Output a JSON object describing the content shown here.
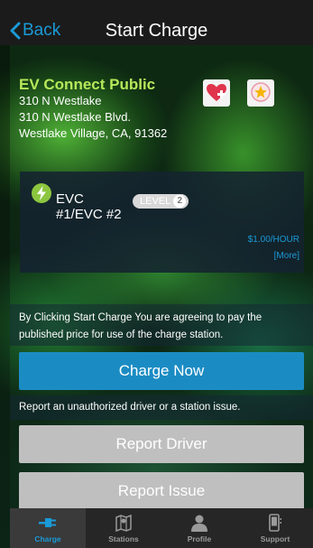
{
  "nav": {
    "back_label": "Back",
    "title": "Start Charge"
  },
  "station": {
    "name": "EV Connect Public",
    "address_line1": "310 N Westlake",
    "address_line2": "310 N Westlake Blvd.",
    "address_line3": "Westlake Village, CA, 91362"
  },
  "actions": {
    "favorite_icon": "heart-plus-icon",
    "rate_icon": "star-badge-icon"
  },
  "charger": {
    "name_line1": "EVC",
    "name_line2": "#1/EVC #2",
    "level_label": "LEVEL",
    "level_number": "2",
    "price": "$1.00/HOUR",
    "more_link": "[More]"
  },
  "agreement_text": "By Clicking Start Charge You are agreeing to pay the published price for use of the charge station.",
  "charge_button": "Charge Now",
  "report_text": "Report an unauthorized driver or a station issue.",
  "report_driver_button": "Report Driver",
  "report_issue_button": "Report Issue",
  "tabs": [
    {
      "label": "Charge",
      "icon": "charge-plug-icon",
      "active": true
    },
    {
      "label": "Stations",
      "icon": "map-icon",
      "active": false
    },
    {
      "label": "Profile",
      "icon": "person-icon",
      "active": false
    },
    {
      "label": "Support",
      "icon": "phone-icon",
      "active": false
    }
  ],
  "colors": {
    "accent": "#1a9ad8",
    "station_name": "#b7e85a",
    "button_grey": "#bfbfbf",
    "charge_button": "#1b8cc3"
  }
}
